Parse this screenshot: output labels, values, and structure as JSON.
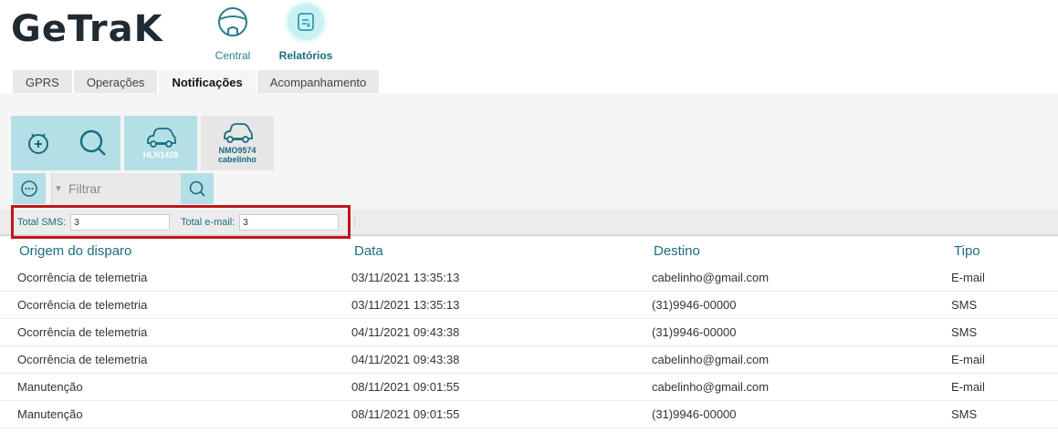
{
  "logo": "GeTraK",
  "nav": {
    "central": "Central",
    "relatorios": "Relatórios"
  },
  "tabs": [
    "GPRS",
    "Operações",
    "Notificações",
    "Acompanhamento"
  ],
  "active_tab": "Notificações",
  "vehicles": [
    {
      "plate": "HLN1428",
      "name": ""
    },
    {
      "plate": "NMO9574",
      "name": "cabelinho"
    }
  ],
  "filter": {
    "placeholder": "Filtrar"
  },
  "totals": {
    "sms_label": "Total SMS:",
    "sms_value": "3",
    "email_label": "Total e-mail:",
    "email_value": "3"
  },
  "table": {
    "headers": [
      "Origem do disparo",
      "Data",
      "Destino",
      "Tipo"
    ],
    "rows": [
      [
        "Ocorrência de telemetria",
        "03/11/2021 13:35:13",
        "cabelinho@gmail.com",
        "E-mail"
      ],
      [
        "Ocorrência de telemetria",
        "03/11/2021 13:35:13",
        "(31)9946-00000",
        "SMS"
      ],
      [
        "Ocorrência de telemetria",
        "04/11/2021 09:43:38",
        "(31)9946-00000",
        "SMS"
      ],
      [
        "Ocorrência de telemetria",
        "04/11/2021 09:43:38",
        "cabelinho@gmail.com",
        "E-mail"
      ],
      [
        "Manutenção",
        "08/11/2021 09:01:55",
        "cabelinho@gmail.com",
        "E-mail"
      ],
      [
        "Manutenção",
        "08/11/2021 09:01:55",
        "(31)9946-00000",
        "SMS"
      ]
    ]
  },
  "colors": {
    "accent": "#1a6d80",
    "button_bg": "#b5dfe6",
    "highlight": "#c0141c"
  },
  "icons": {
    "central": "steering-wheel-icon",
    "relatorios": "report-icon",
    "add": "add-device-icon",
    "search": "search-icon",
    "vehicle": "car-icon",
    "more": "more-icon"
  }
}
